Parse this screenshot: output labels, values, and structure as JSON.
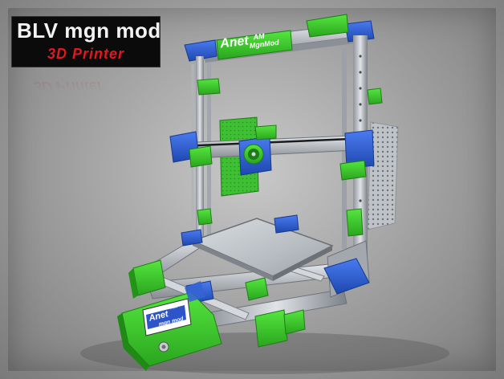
{
  "logo": {
    "title": "BLV mgn mod",
    "subtitle": "3D Printer"
  },
  "frame_brand": {
    "line1": "Anet",
    "line2": "AM",
    "line3": "MgnMod"
  },
  "lcd_brand": {
    "line1": "Anet",
    "line2": "AM",
    "line3": "mgn mod"
  },
  "colors": {
    "accent_green": "#3fcf2f",
    "accent_blue": "#2f62d6",
    "aluminium": "#c3c7cc",
    "logo_red": "#e0191f"
  }
}
